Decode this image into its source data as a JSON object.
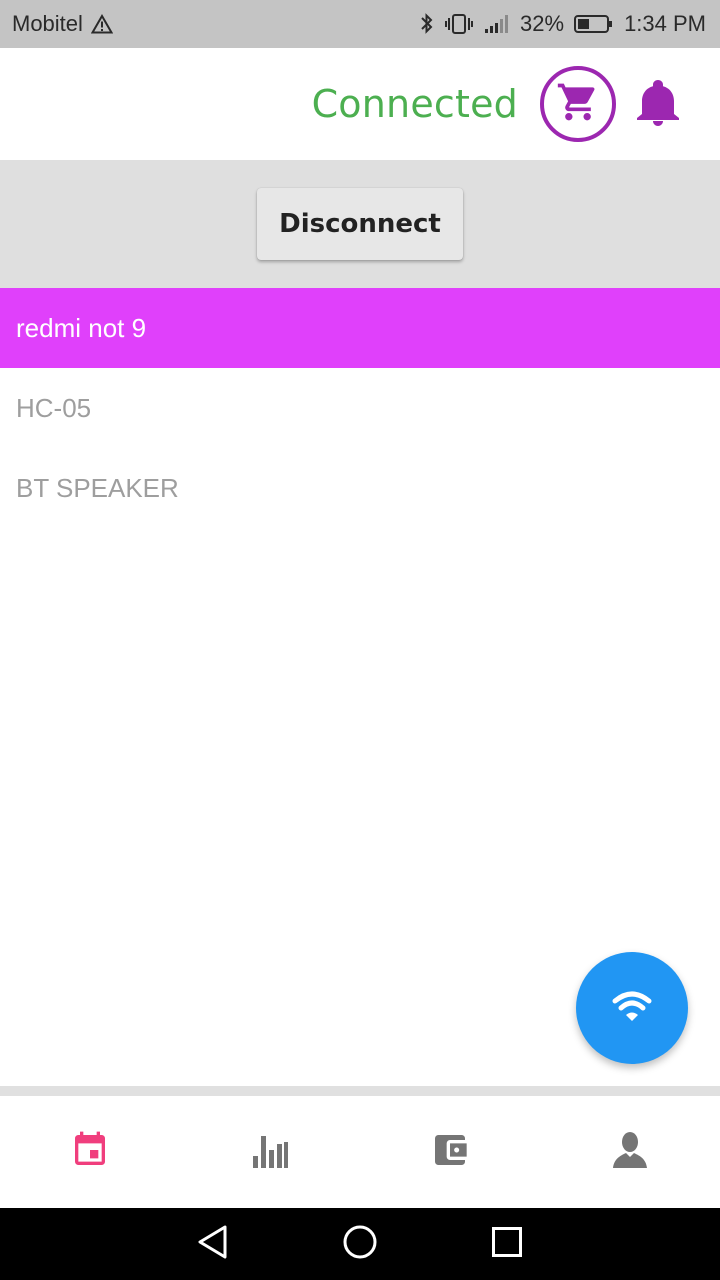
{
  "status_bar": {
    "carrier": "Mobitel",
    "battery_percent": "32%",
    "time": "1:34 PM",
    "icons": [
      "warning-icon",
      "bluetooth-icon",
      "vibrate-icon",
      "signal-icon",
      "battery-icon"
    ]
  },
  "header": {
    "connection_status": "Connected",
    "icons": [
      "cart-icon",
      "bell-icon"
    ],
    "status_color": "#4caf50",
    "accent_color": "#9c27b0"
  },
  "actions": {
    "disconnect_label": "Disconnect"
  },
  "devices": [
    {
      "name": "redmi not 9",
      "selected": true
    },
    {
      "name": "HC-05",
      "selected": false
    },
    {
      "name": "BT SPEAKER",
      "selected": false
    }
  ],
  "selection_color": "#e040fb",
  "fab": {
    "icon": "wifi-icon",
    "color": "#2196f3"
  },
  "bottom_nav": {
    "items": [
      {
        "icon": "calendar-icon",
        "active": true
      },
      {
        "icon": "bar-chart-icon",
        "active": false
      },
      {
        "icon": "wallet-icon",
        "active": false
      },
      {
        "icon": "person-icon",
        "active": false
      }
    ],
    "active_color": "#f03e7d",
    "inactive_color": "#757575"
  },
  "system_nav": {
    "icons": [
      "back-icon",
      "home-icon",
      "recents-icon"
    ]
  }
}
